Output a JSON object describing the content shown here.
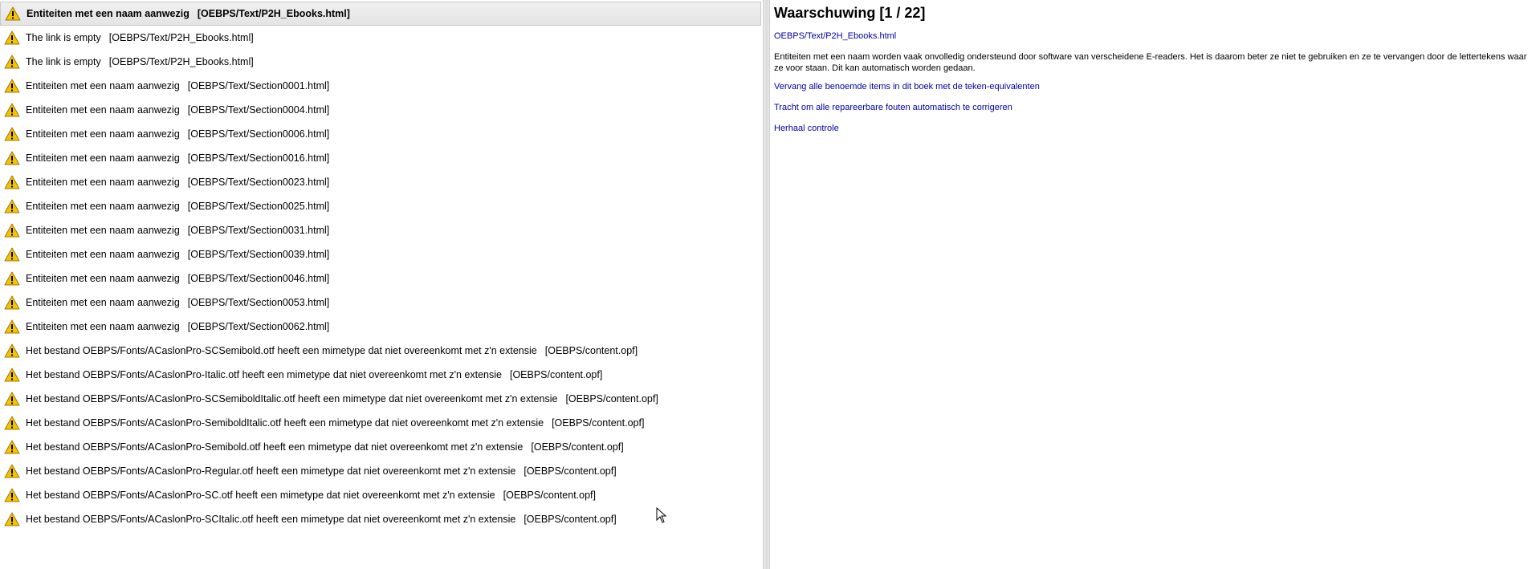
{
  "warnings": [
    {
      "message": "Entiteiten met een naam aanwezig",
      "path": "[OEBPS/Text/P2H_Ebooks.html]",
      "selected": true
    },
    {
      "message": "The link is empty",
      "path": "[OEBPS/Text/P2H_Ebooks.html]"
    },
    {
      "message": "The link is empty",
      "path": "[OEBPS/Text/P2H_Ebooks.html]"
    },
    {
      "message": "Entiteiten met een naam aanwezig",
      "path": "[OEBPS/Text/Section0001.html]"
    },
    {
      "message": "Entiteiten met een naam aanwezig",
      "path": "[OEBPS/Text/Section0004.html]"
    },
    {
      "message": "Entiteiten met een naam aanwezig",
      "path": "[OEBPS/Text/Section0006.html]"
    },
    {
      "message": "Entiteiten met een naam aanwezig",
      "path": "[OEBPS/Text/Section0016.html]"
    },
    {
      "message": "Entiteiten met een naam aanwezig",
      "path": "[OEBPS/Text/Section0023.html]"
    },
    {
      "message": "Entiteiten met een naam aanwezig",
      "path": "[OEBPS/Text/Section0025.html]"
    },
    {
      "message": "Entiteiten met een naam aanwezig",
      "path": "[OEBPS/Text/Section0031.html]"
    },
    {
      "message": "Entiteiten met een naam aanwezig",
      "path": "[OEBPS/Text/Section0039.html]"
    },
    {
      "message": "Entiteiten met een naam aanwezig",
      "path": "[OEBPS/Text/Section0046.html]"
    },
    {
      "message": "Entiteiten met een naam aanwezig",
      "path": "[OEBPS/Text/Section0053.html]"
    },
    {
      "message": "Entiteiten met een naam aanwezig",
      "path": "[OEBPS/Text/Section0062.html]"
    },
    {
      "message": "Het bestand OEBPS/Fonts/ACaslonPro-SCSemibold.otf heeft een mimetype dat niet overeenkomt met z'n extensie",
      "path": "[OEBPS/content.opf]"
    },
    {
      "message": "Het bestand OEBPS/Fonts/ACaslonPro-Italic.otf heeft een mimetype dat niet overeenkomt met z'n extensie",
      "path": "[OEBPS/content.opf]"
    },
    {
      "message": "Het bestand OEBPS/Fonts/ACaslonPro-SCSemiboldItalic.otf heeft een mimetype dat niet overeenkomt met z'n extensie",
      "path": "[OEBPS/content.opf]"
    },
    {
      "message": "Het bestand OEBPS/Fonts/ACaslonPro-SemiboldItalic.otf heeft een mimetype dat niet overeenkomt met z'n extensie",
      "path": "[OEBPS/content.opf]"
    },
    {
      "message": "Het bestand OEBPS/Fonts/ACaslonPro-Semibold.otf heeft een mimetype dat niet overeenkomt met z'n extensie",
      "path": "[OEBPS/content.opf]"
    },
    {
      "message": "Het bestand OEBPS/Fonts/ACaslonPro-Regular.otf heeft een mimetype dat niet overeenkomt met z'n extensie",
      "path": "[OEBPS/content.opf]"
    },
    {
      "message": "Het bestand OEBPS/Fonts/ACaslonPro-SC.otf heeft een mimetype dat niet overeenkomt met z'n extensie",
      "path": "[OEBPS/content.opf]"
    },
    {
      "message": "Het bestand OEBPS/Fonts/ACaslonPro-SCItalic.otf heeft een mimetype dat niet overeenkomt met z'n extensie",
      "path": "[OEBPS/content.opf]"
    }
  ],
  "detail": {
    "title": "Waarschuwing [1 / 22]",
    "file_link": "OEBPS/Text/P2H_Ebooks.html",
    "description": "Entiteiten met een naam worden vaak onvolledig ondersteund door software van verscheidene E-readers. Het is daarom beter ze niet te gebruiken en ze te vervangen door de lettertekens waar ze voor staan. Dit kan automatisch worden gedaan.",
    "actions": {
      "replace_entities": "Vervang alle benoemde items in dit boek met de teken-equivalenten",
      "auto_fix": "Tracht om alle repareerbare fouten automatisch te corrigeren",
      "recheck": "Herhaal controle"
    }
  },
  "icons": {
    "warning": "warning-triangle-icon",
    "cursor": "mouse-pointer-icon"
  },
  "colors": {
    "link": "#0000aa",
    "warning_fill": "#f5c400",
    "selected_row": "#e8e8e8"
  }
}
